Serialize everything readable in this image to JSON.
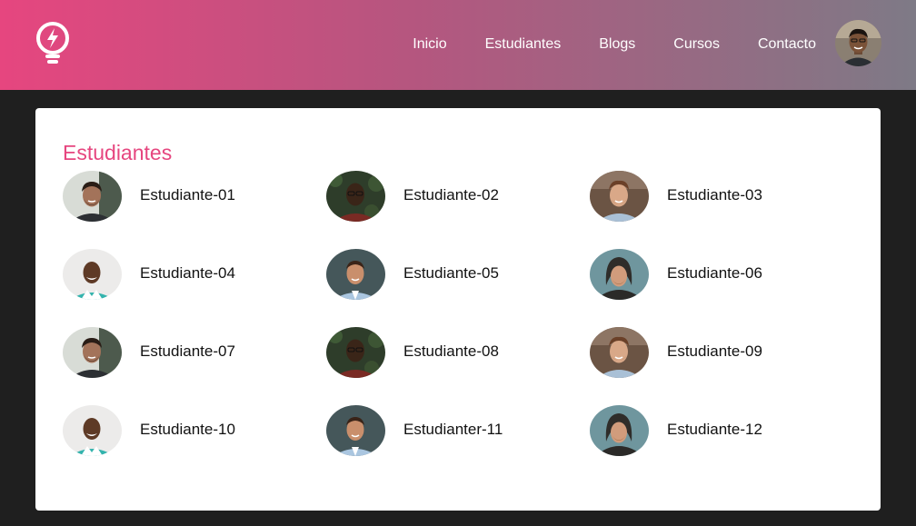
{
  "header": {
    "logo": {
      "icon": "lightbulb-bolt-icon"
    },
    "nav": [
      {
        "label": "Inicio"
      },
      {
        "label": "Estudiantes"
      },
      {
        "label": "Blogs"
      },
      {
        "label": "Cursos"
      },
      {
        "label": "Contacto"
      }
    ],
    "user_avatar": {
      "icon": "user-avatar-photo"
    }
  },
  "main": {
    "title": "Estudiantes",
    "students": [
      {
        "name": "Estudiante-01",
        "photo": "A"
      },
      {
        "name": "Estudiante-02",
        "photo": "B"
      },
      {
        "name": "Estudiante-03",
        "photo": "C"
      },
      {
        "name": "Estudiante-04",
        "photo": "D"
      },
      {
        "name": "Estudiante-05",
        "photo": "E"
      },
      {
        "name": "Estudiante-06",
        "photo": "F"
      },
      {
        "name": "Estudiante-07",
        "photo": "A"
      },
      {
        "name": "Estudiante-08",
        "photo": "B"
      },
      {
        "name": "Estudiante-09",
        "photo": "C"
      },
      {
        "name": "Estudiante-10",
        "photo": "D"
      },
      {
        "name": "Estudianter-11",
        "photo": "E"
      },
      {
        "name": "Estudiante-12",
        "photo": "F"
      }
    ]
  },
  "colors": {
    "accent": "#e6467f",
    "header_gradient_start": "#e6467f",
    "header_gradient_end": "#7e7a86",
    "page_background": "#1f1f1f",
    "card_background": "#ffffff"
  }
}
